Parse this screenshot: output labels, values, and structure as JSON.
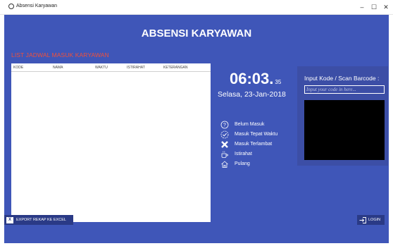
{
  "window": {
    "title": "Absensi Karyawan",
    "minimize": "–",
    "maximize": "☐",
    "close": "✕"
  },
  "app": {
    "heading": "ABSENSI KARYAWAN",
    "list_title": "LIST JADWAL MASUK KARYAWAN",
    "table": {
      "columns": [
        "KODE",
        "NAMA",
        "WAKTU",
        "ISTIRAHAT",
        "KETERANGAN"
      ],
      "rows": []
    },
    "clock": {
      "hm": "06:03.",
      "sec": "35"
    },
    "date": "Selasa, 23-Jan-2018",
    "legend": [
      {
        "icon": "question-icon",
        "label": "Belum Masuk"
      },
      {
        "icon": "check-badge-icon",
        "label": "Masuk Tepat Waktu"
      },
      {
        "icon": "x-icon",
        "label": "Masuk Terlambat"
      },
      {
        "icon": "coffee-icon",
        "label": "Istirahat"
      },
      {
        "icon": "home-icon",
        "label": "Pulang"
      }
    ],
    "input_panel": {
      "label": "Input Kode / Scan Barcode :",
      "placeholder": "Input your code in here..."
    },
    "buttons": {
      "export": "EXPORT REKAP KE EXCEL",
      "login": "LOGIN"
    },
    "colors": {
      "background": "#3f56b8",
      "button": "#2a3a86",
      "list_title": "#f0503a"
    }
  }
}
